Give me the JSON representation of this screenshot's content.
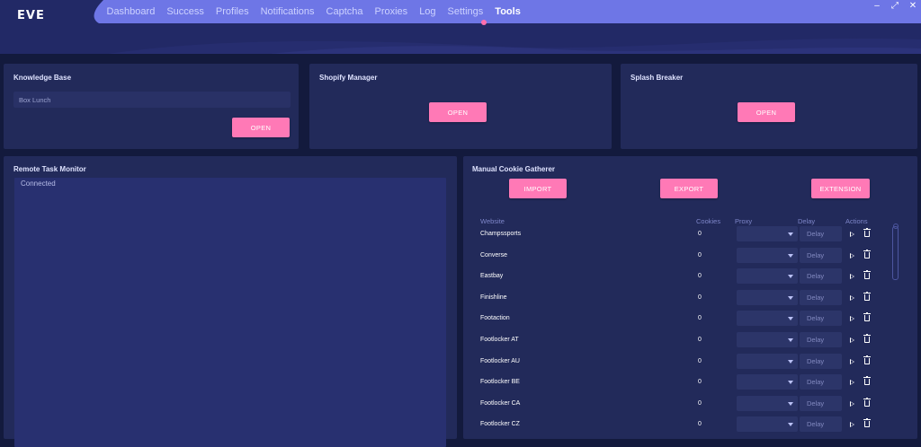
{
  "app": {
    "logo": "EVE"
  },
  "nav": {
    "items": [
      {
        "label": "Dashboard"
      },
      {
        "label": "Success"
      },
      {
        "label": "Profiles"
      },
      {
        "label": "Notifications"
      },
      {
        "label": "Captcha"
      },
      {
        "label": "Proxies"
      },
      {
        "label": "Log"
      },
      {
        "label": "Settings"
      },
      {
        "label": "Tools",
        "active": true
      }
    ],
    "accent": "#ff6fae"
  },
  "window_controls": {
    "minimize": "–",
    "maximize": "⤢",
    "close": "✕"
  },
  "knowledge_base": {
    "title": "Knowledge Base",
    "input_value": "Box Lunch",
    "open_label": "OPEN"
  },
  "shopify_manager": {
    "title": "Shopify Manager",
    "open_label": "OPEN"
  },
  "splash_breaker": {
    "title": "Splash Breaker",
    "open_label": "OPEN"
  },
  "remote_task_monitor": {
    "title": "Remote Task Monitor",
    "status": "Connected"
  },
  "cookie_gatherer": {
    "title": "Manual Cookie Gatherer",
    "import_label": "IMPORT",
    "export_label": "EXPORT",
    "extension_label": "EXTENSION",
    "columns": {
      "website": "Website",
      "cookies": "Cookies",
      "proxy": "Proxy",
      "delay": "Delay",
      "actions": "Actions"
    },
    "delay_placeholder": "Delay",
    "rows": [
      {
        "website": "Champssports",
        "cookies": "0"
      },
      {
        "website": "Converse",
        "cookies": "0"
      },
      {
        "website": "Eastbay",
        "cookies": "0"
      },
      {
        "website": "Finishline",
        "cookies": "0"
      },
      {
        "website": "Footaction",
        "cookies": "0"
      },
      {
        "website": "Footlocker AT",
        "cookies": "0"
      },
      {
        "website": "Footlocker AU",
        "cookies": "0"
      },
      {
        "website": "Footlocker BE",
        "cookies": "0"
      },
      {
        "website": "Footlocker CA",
        "cookies": "0"
      },
      {
        "website": "Footlocker CZ",
        "cookies": "0"
      }
    ]
  },
  "colors": {
    "background": "#131a3d",
    "panel": "#222a5a",
    "button": "#ff79b6"
  }
}
